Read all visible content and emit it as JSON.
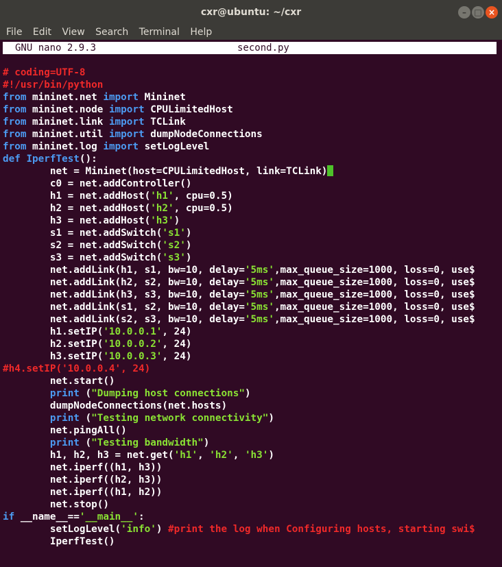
{
  "window": {
    "title": "cxr@ubuntu: ~/cxr",
    "buttons": {
      "minimize": "–",
      "maximize": "□",
      "close": "×"
    }
  },
  "menu": [
    "File",
    "Edit",
    "View",
    "Search",
    "Terminal",
    "Help"
  ],
  "nano": {
    "version": "GNU nano 2.9.3",
    "filename": "second.py"
  },
  "colors": {
    "background": "#300a24",
    "keyword": "#4c9bf2",
    "string": "#8ae234",
    "comment": "#ef2929",
    "cursor": "#4ec22a"
  },
  "lines": [
    [
      [
        "c",
        "# coding=UTF-8"
      ]
    ],
    [
      [
        "c",
        "#!/usr/bin/python"
      ]
    ],
    [
      [
        "k",
        "from"
      ],
      [
        "t",
        " mininet.net "
      ],
      [
        "k",
        "import"
      ],
      [
        "t",
        " Mininet"
      ]
    ],
    [
      [
        "k",
        "from"
      ],
      [
        "t",
        " mininet.node "
      ],
      [
        "k",
        "import"
      ],
      [
        "t",
        " CPULimitedHost"
      ]
    ],
    [
      [
        "k",
        "from"
      ],
      [
        "t",
        " mininet.link "
      ],
      [
        "k",
        "import"
      ],
      [
        "t",
        " TCLink"
      ]
    ],
    [
      [
        "k",
        "from"
      ],
      [
        "t",
        " mininet.util "
      ],
      [
        "k",
        "import"
      ],
      [
        "t",
        " dumpNodeConnections"
      ]
    ],
    [
      [
        "k",
        "from"
      ],
      [
        "t",
        " mininet.log "
      ],
      [
        "k",
        "import"
      ],
      [
        "t",
        " setLogLevel"
      ]
    ],
    [
      [
        "k",
        "def"
      ],
      [
        "t",
        " "
      ],
      [
        "k",
        "IperfTest"
      ],
      [
        "t",
        "():"
      ]
    ],
    [
      [
        "t",
        "        net = Mininet(host=CPULimitedHost, link=TCLink)"
      ],
      [
        "cur",
        ""
      ]
    ],
    [
      [
        "t",
        "        c0 = net.addController()"
      ]
    ],
    [
      [
        "t",
        "        h1 = net.addHost("
      ],
      [
        "s",
        "'h1'"
      ],
      [
        "t",
        ", cpu=0.5)"
      ]
    ],
    [
      [
        "t",
        "        h2 = net.addHost("
      ],
      [
        "s",
        "'h2'"
      ],
      [
        "t",
        ", cpu=0.5)"
      ]
    ],
    [
      [
        "t",
        "        h3 = net.addHost("
      ],
      [
        "s",
        "'h3'"
      ],
      [
        "t",
        ")"
      ]
    ],
    [
      [
        "t",
        "        s1 = net.addSwitch("
      ],
      [
        "s",
        "'s1'"
      ],
      [
        "t",
        ")"
      ]
    ],
    [
      [
        "t",
        "        s2 = net.addSwitch("
      ],
      [
        "s",
        "'s2'"
      ],
      [
        "t",
        ")"
      ]
    ],
    [
      [
        "t",
        "        s3 = net.addSwitch("
      ],
      [
        "s",
        "'s3'"
      ],
      [
        "t",
        ")"
      ]
    ],
    [
      [
        "t",
        "        net.addLink(h1, s1, bw=10, delay="
      ],
      [
        "s",
        "'5ms'"
      ],
      [
        "t",
        ",max_queue_size=1000, loss=0, use$"
      ]
    ],
    [
      [
        "t",
        "        net.addLink(h2, s2, bw=10, delay="
      ],
      [
        "s",
        "'5ms'"
      ],
      [
        "t",
        ",max_queue_size=1000, loss=0, use$"
      ]
    ],
    [
      [
        "t",
        "        net.addLink(h3, s3, bw=10, delay="
      ],
      [
        "s",
        "'5ms'"
      ],
      [
        "t",
        ",max_queue_size=1000, loss=0, use$"
      ]
    ],
    [
      [
        "t",
        "        net.addLink(s1, s2, bw=10, delay="
      ],
      [
        "s",
        "'5ms'"
      ],
      [
        "t",
        ",max_queue_size=1000, loss=0, use$"
      ]
    ],
    [
      [
        "t",
        "        net.addLink(s2, s3, bw=10, delay="
      ],
      [
        "s",
        "'5ms'"
      ],
      [
        "t",
        ",max_queue_size=1000, loss=0, use$"
      ]
    ],
    [
      [
        "t",
        "        h1.setIP("
      ],
      [
        "s",
        "'10.0.0.1'"
      ],
      [
        "t",
        ", 24)"
      ]
    ],
    [
      [
        "t",
        "        h2.setIP("
      ],
      [
        "s",
        "'10.0.0.2'"
      ],
      [
        "t",
        ", 24)"
      ]
    ],
    [
      [
        "t",
        "        h3.setIP("
      ],
      [
        "s",
        "'10.0.0.3'"
      ],
      [
        "t",
        ", 24)"
      ]
    ],
    [
      [
        "c",
        "#h4.setIP('10.0.0.4', 24)"
      ]
    ],
    [
      [
        "t",
        "        net.start()"
      ]
    ],
    [
      [
        "t",
        "        "
      ],
      [
        "k",
        "print"
      ],
      [
        "t",
        " ("
      ],
      [
        "s",
        "\"Dumping host connections\""
      ],
      [
        "t",
        ")"
      ]
    ],
    [
      [
        "t",
        "        dumpNodeConnections(net.hosts)"
      ]
    ],
    [
      [
        "t",
        "        "
      ],
      [
        "k",
        "print"
      ],
      [
        "t",
        " ("
      ],
      [
        "s",
        "\"Testing network connectivity\""
      ],
      [
        "t",
        ")"
      ]
    ],
    [
      [
        "t",
        "        net.pingAll()"
      ]
    ],
    [
      [
        "t",
        "        "
      ],
      [
        "k",
        "print"
      ],
      [
        "t",
        " ("
      ],
      [
        "s",
        "\"Testing bandwidth\""
      ],
      [
        "t",
        ")"
      ]
    ],
    [
      [
        "t",
        "        h1, h2, h3 = net.get("
      ],
      [
        "s",
        "'h1'"
      ],
      [
        "t",
        ", "
      ],
      [
        "s",
        "'h2'"
      ],
      [
        "t",
        ", "
      ],
      [
        "s",
        "'h3'"
      ],
      [
        "t",
        ")"
      ]
    ],
    [
      [
        "t",
        "        net.iperf((h1, h3))"
      ]
    ],
    [
      [
        "t",
        "        net.iperf((h2, h3))"
      ]
    ],
    [
      [
        "t",
        "        net.iperf((h1, h2))"
      ]
    ],
    [
      [
        "t",
        "        net.stop()"
      ]
    ],
    [
      [
        "k",
        "if"
      ],
      [
        "t",
        " __name__=="
      ],
      [
        "s",
        "'__main__'"
      ],
      [
        "t",
        ":"
      ]
    ],
    [
      [
        "t",
        "        setLogLevel("
      ],
      [
        "s",
        "'info'"
      ],
      [
        "t",
        ") "
      ],
      [
        "c",
        "#print the log when Configuring hosts, starting swi$"
      ]
    ],
    [
      [
        "t",
        "        IperfTest()"
      ]
    ]
  ]
}
